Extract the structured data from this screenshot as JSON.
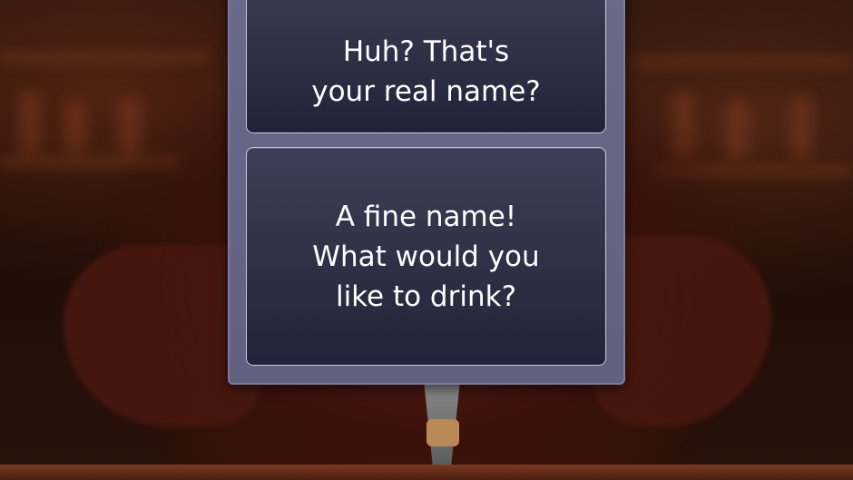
{
  "dialog": {
    "choices": [
      {
        "label": "Huh? That's\nyour real name?"
      },
      {
        "label": "A fine name!\nWhat would you\nlike to drink?"
      }
    ]
  },
  "colors": {
    "panel": "#65658a",
    "button_top": "#3e3e58",
    "button_bottom": "#22223a",
    "button_border": "#c9c9dc",
    "text": "#ffffff"
  }
}
